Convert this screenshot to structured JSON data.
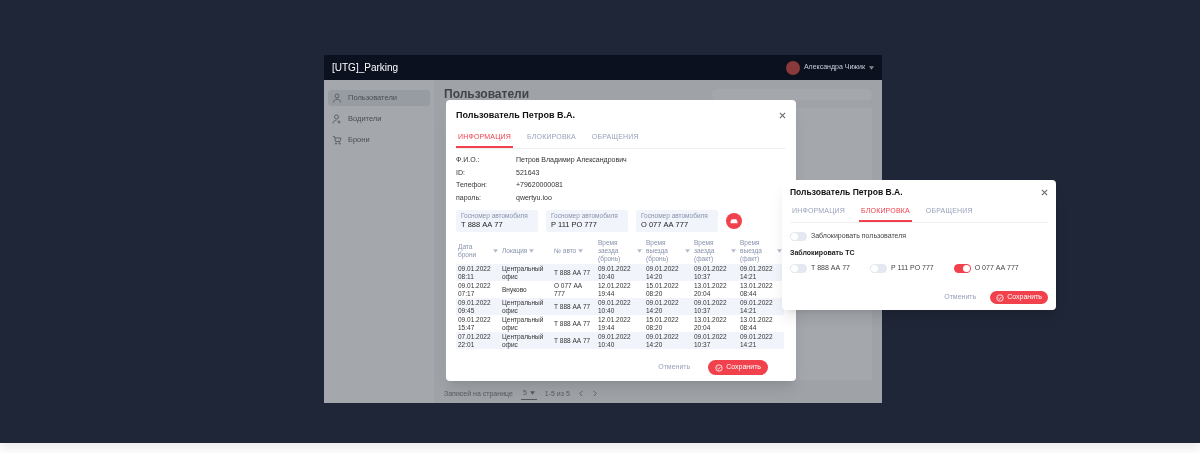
{
  "app": {
    "title": "[UTG]_Parking",
    "user_name": "Александра Чижик",
    "sidebar": {
      "items": [
        {
          "label": "Пользователи",
          "selected": true
        },
        {
          "label": "Водители",
          "selected": false
        },
        {
          "label": "Брони",
          "selected": false
        }
      ]
    },
    "page_title": "Пользователи",
    "pagination": {
      "label": "Записей на странице",
      "page_size": "5",
      "range": "1-5 из 5"
    }
  },
  "user_dialog": {
    "title": "Пользователь Петров В.А.",
    "tabs": [
      {
        "label": "ИНФОРМАЦИЯ",
        "selected": true
      },
      {
        "label": "БЛОКИРОВКА",
        "selected": false
      },
      {
        "label": "ОБРАЩЕНИЯ",
        "selected": false
      }
    ],
    "fields": [
      {
        "label": "Ф.И.О.:",
        "value": "Петров Владимир Александрович"
      },
      {
        "label": "ID:",
        "value": "521643"
      },
      {
        "label": "Телефон:",
        "value": "+79620000081"
      },
      {
        "label": "пароль:",
        "value": "qwertyu.ioo"
      }
    ],
    "vehicles": [
      {
        "placeholder": "Госномер автомобиля",
        "value": "Т 888 АА 77"
      },
      {
        "placeholder": "Госномер автомобиля",
        "value": "Р 111 РО 777"
      },
      {
        "placeholder": "Госномер автомобиля",
        "value": "О 077 АА 777"
      }
    ],
    "table": {
      "columns": [
        "Дата брони",
        "Локация",
        "№ авто",
        "Время заезда (бронь)",
        "Время выезда (бронь)",
        "Время заезда (факт)",
        "Время выезда (факт)"
      ],
      "rows": [
        [
          "09.01.2022 08:11",
          "Центральный офис",
          "Т 888 АА 77",
          "09.01.2022 10:40",
          "09.01.2022 14:20",
          "09.01.2022 10:37",
          "09.01.2022 14:21"
        ],
        [
          "09.01.2022 07:17",
          "Внуково",
          "О 077 АА 777",
          "12.01.2022 19:44",
          "15.01.2022 08:20",
          "13.01.2022 20:04",
          "13.01.2022 08:44"
        ],
        [
          "09.01.2022 09:45",
          "Центральный офис",
          "Т 888 АА 77",
          "09.01.2022 10:40",
          "09.01.2022 14:20",
          "09.01.2022 10:37",
          "09.01.2022 14:21"
        ],
        [
          "09.01.2022 15:47",
          "Центральный офис",
          "Т 888 АА 77",
          "12.01.2022 19:44",
          "15.01.2022 08:20",
          "13.01.2022 20:04",
          "13.01.2022 08:44"
        ],
        [
          "07.01.2022 22:01",
          "Центральный офис",
          "Т 888 АА 77",
          "09.01.2022 10:40",
          "09.01.2022 14:20",
          "09.01.2022 10:37",
          "09.01.2022 14:21"
        ]
      ]
    },
    "buttons": {
      "cancel": "Отменить",
      "save": "Сохранить"
    }
  },
  "block_dialog": {
    "title": "Пользователь Петров В.А.",
    "tabs": [
      {
        "label": "ИНФОРМАЦИЯ",
        "selected": false
      },
      {
        "label": "БЛОКИРОВКА",
        "selected": true
      },
      {
        "label": "ОБРАЩЕНИЯ",
        "selected": false
      }
    ],
    "block_user": {
      "label": "Заблокировать пользователя",
      "on": false
    },
    "vehicles_heading": "Заблокировать ТС",
    "vehicles": [
      {
        "label": "Т 888 АА 77",
        "on": false
      },
      {
        "label": "Р 111 РО 777",
        "on": false
      },
      {
        "label": "О 077 АА 777",
        "on": true
      }
    ],
    "buttons": {
      "cancel": "Отменить",
      "save": "Сохранить"
    }
  }
}
